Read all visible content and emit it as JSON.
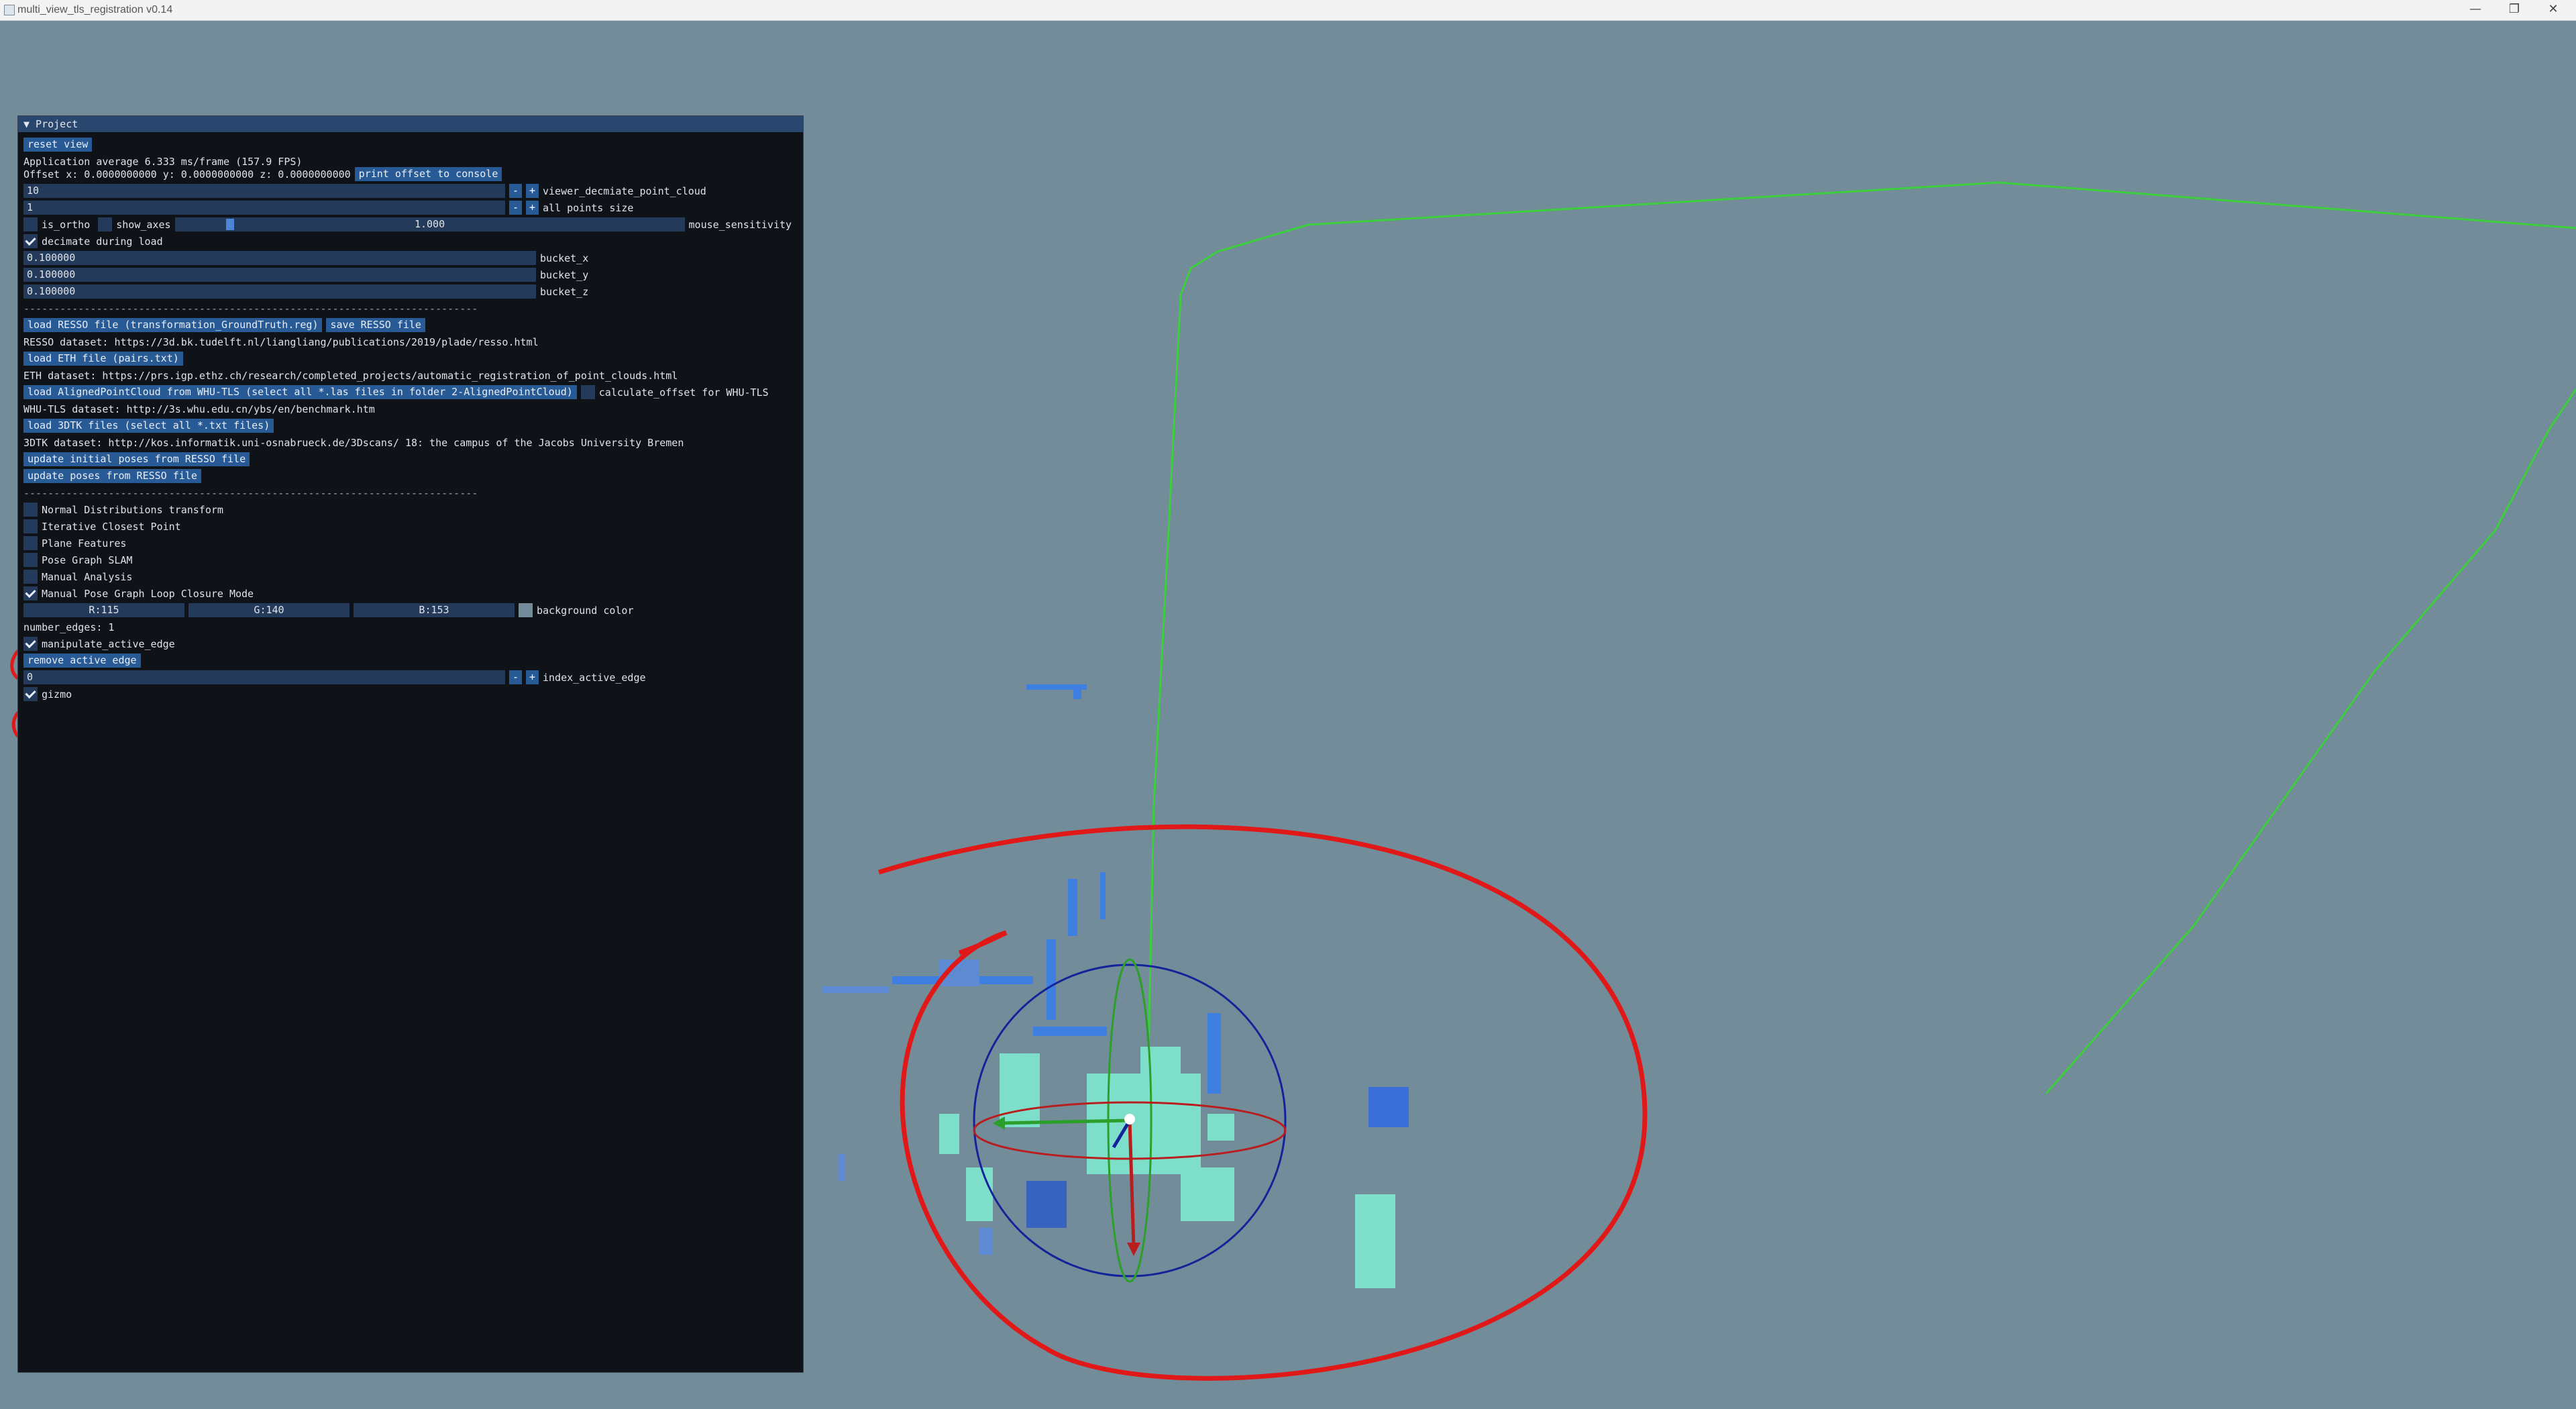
{
  "window": {
    "title": "multi_view_tls_registration v0.14",
    "minimize": "—",
    "restore": "❐",
    "close": "✕"
  },
  "panel": {
    "header": "▼ Project",
    "reset_view": "reset view",
    "fps_text": "Application average 6.333 ms/frame (157.9 FPS)",
    "offset_text": "Offset x: 0.0000000000 y: 0.0000000000 z: 0.0000000000",
    "print_offset": "print offset to console",
    "decimate_value": "10",
    "decimate_label": "viewer_decmiate_point_cloud",
    "points_size_value": "1",
    "points_size_label": "all points size",
    "minus": "-",
    "plus": "+",
    "is_ortho": "is_ortho",
    "show_axes": "show_axes",
    "mouse_sensitivity_value": "1.000",
    "mouse_sensitivity_label": "mouse_sensitivity",
    "mouse_sensitivity_fraction": 0.1,
    "decimate_during_load": "decimate during load",
    "bucket_x_value": "0.100000",
    "bucket_x_label": "bucket_x",
    "bucket_y_value": "0.100000",
    "bucket_y_label": "bucket_y",
    "bucket_z_value": "0.100000",
    "bucket_z_label": "bucket_z",
    "separator": "---------------------------------------------------------------------------",
    "load_resso": "load RESSO file (transformation_GroundTruth.reg)",
    "save_resso": "save RESSO file",
    "resso_dataset": "RESSO dataset: https://3d.bk.tudelft.nl/liangliang/publications/2019/plade/resso.html",
    "load_eth": "load ETH file (pairs.txt)",
    "eth_dataset": "ETH dataset: https://prs.igp.ethz.ch/research/completed_projects/automatic_registration_of_point_clouds.html",
    "load_whu": "load AlignedPointCloud from WHU-TLS (select all *.las files in folder 2-AlignedPointCloud)",
    "calc_offset_whu": "calculate_offset for WHU-TLS",
    "whu_dataset": "WHU-TLS dataset: http://3s.whu.edu.cn/ybs/en/benchmark.htm",
    "load_3dtk": "load 3DTK files (select all *.txt files)",
    "dtk_dataset": "3DTK dataset: http://kos.informatik.uni-osnabrueck.de/3Dscans/ 18: the campus of the Jacobs University Bremen",
    "update_initial": "update initial poses from RESSO file",
    "update_poses": "update poses from RESSO file",
    "ndt": "Normal Distributions transform",
    "icp": "Iterative Closest Point",
    "plane": "Plane Features",
    "pgslam": "Pose Graph SLAM",
    "manual_analysis": "Manual Analysis",
    "manual_pg": "Manual Pose Graph Loop Closure Mode",
    "r": "R:115",
    "g": "G:140",
    "b": "B:153",
    "bg_label": "background color",
    "bg_color": "#738c99",
    "number_edges": "number_edges: 1",
    "manipulate": "manipulate_active_edge",
    "remove_edge": "remove active edge",
    "index_value": "0",
    "index_label": "index_active_edge",
    "gizmo": "gizmo"
  },
  "colors": {
    "trajectory": "#3ccf3c",
    "annotation": "#e01818",
    "points": "#3f7fe0",
    "points_dense": "#7fe8d0"
  }
}
